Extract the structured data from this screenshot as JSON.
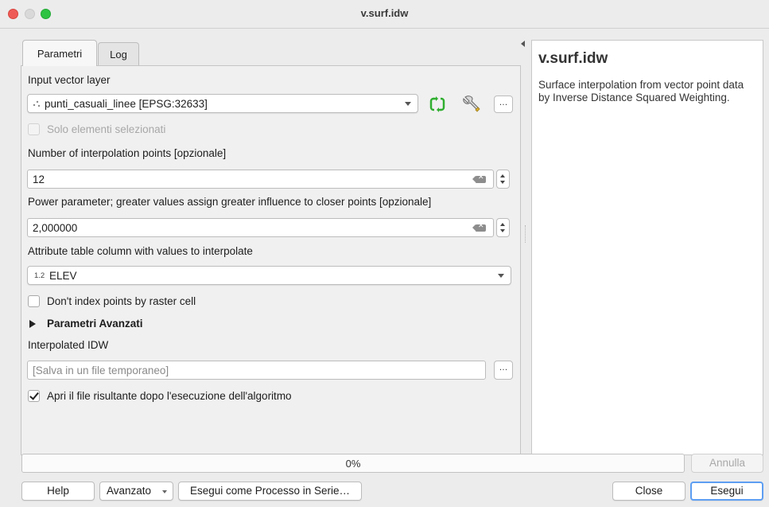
{
  "window": {
    "title": "v.surf.idw"
  },
  "tabs": [
    {
      "label": "Parametri",
      "active": true
    },
    {
      "label": "Log",
      "active": false
    }
  ],
  "params": {
    "input_layer": {
      "label": "Input vector layer",
      "value": "punti_casuali_linee [EPSG:32633]",
      "layer_icon": "point-layer-icon",
      "more_button": "…"
    },
    "selected_only": {
      "label": "Solo elementi selezionati",
      "checked": false,
      "enabled": false
    },
    "npoints": {
      "label": "Number of interpolation points [opzionale]",
      "value": "12"
    },
    "power": {
      "label": "Power parameter; greater values assign greater influence to closer points [opzionale]",
      "value": "2,000000"
    },
    "column": {
      "label": "Attribute table column with values to interpolate",
      "type_badge": "1.2",
      "value": "ELEV"
    },
    "noindex": {
      "label": "Don't index points by raster cell",
      "checked": false
    },
    "advanced": {
      "label": "Parametri Avanzati",
      "expanded": false
    },
    "output": {
      "label": "Interpolated IDW",
      "placeholder": "[Salva in un file temporaneo]",
      "more_button": "…"
    },
    "open_result": {
      "label": "Apri il file risultante dopo l'esecuzione dell'algoritmo",
      "checked": true
    }
  },
  "help": {
    "title": "v.surf.idw",
    "description": "Surface interpolation from vector point data by Inverse Distance Squared Weighting."
  },
  "progress": {
    "value": 0,
    "label": "0%"
  },
  "buttons": {
    "cancel": "Annulla",
    "help": "Help",
    "advanced": "Avanzato",
    "batch": "Esegui come Processo in Serie…",
    "close": "Close",
    "run": "Esegui"
  },
  "colors": {
    "accent": "#3f88e6",
    "default_button_border": "#5d9ef2",
    "sync_icon": "#2fae2f"
  }
}
